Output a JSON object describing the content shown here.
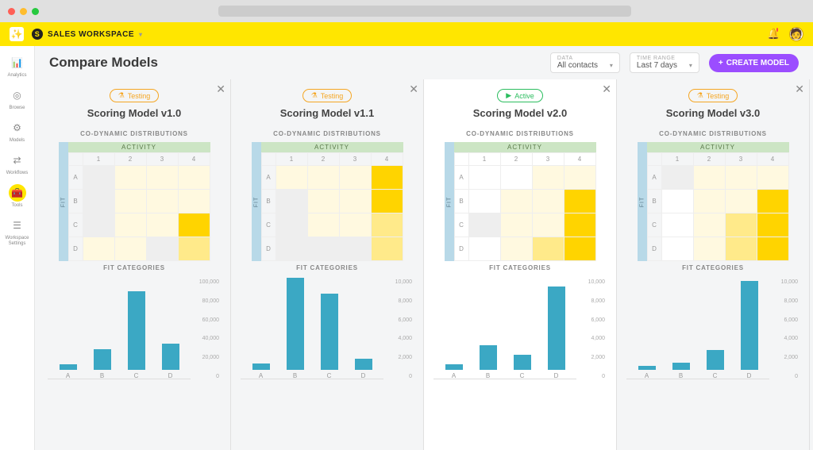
{
  "browser": {
    "traffic": [
      "red",
      "yellow",
      "green"
    ]
  },
  "topbar": {
    "workspace_label": "SALES WORKSPACE",
    "bell_icon": "🔔",
    "avatar_icon": "👤"
  },
  "sidebar": {
    "items": [
      {
        "icon": "📊",
        "label": "Analytics"
      },
      {
        "icon": "◎",
        "label": "Browse"
      },
      {
        "icon": "⚙",
        "label": "Models"
      },
      {
        "icon": "⇄",
        "label": "Workflows"
      },
      {
        "icon": "🧰",
        "label": "Tools",
        "active": true
      },
      {
        "icon": "☰",
        "label": "Workspace Settings"
      }
    ]
  },
  "header": {
    "title": "Compare Models",
    "data_label": "DATA",
    "data_value": "All contacts",
    "time_label": "TIME RANGE",
    "time_value": "Last 7 days",
    "create_label": "CREATE MODEL"
  },
  "status_labels": {
    "testing": "Testing",
    "active": "Active"
  },
  "section_labels": {
    "distributions": "CO-DYNAMIC DISTRIBUTIONS",
    "activity": "ACTIVITY",
    "fit": "FIT",
    "fit_categories": "FIT CATEGORIES"
  },
  "heatmap_axes": {
    "cols": [
      "1",
      "2",
      "3",
      "4"
    ],
    "rows": [
      "A",
      "B",
      "C",
      "D"
    ]
  },
  "panels": [
    {
      "status": "testing",
      "title": "Scoring Model v1.0",
      "heatmap": [
        [
          2,
          1,
          1,
          1
        ],
        [
          2,
          1,
          1,
          1
        ],
        [
          2,
          1,
          1,
          5
        ],
        [
          1,
          1,
          2,
          3
        ]
      ],
      "highlight": false
    },
    {
      "status": "testing",
      "title": "Scoring Model v1.1",
      "heatmap": [
        [
          1,
          1,
          1,
          5
        ],
        [
          2,
          1,
          1,
          5
        ],
        [
          2,
          1,
          1,
          3
        ],
        [
          2,
          2,
          2,
          3
        ]
      ],
      "highlight": false
    },
    {
      "status": "active",
      "title": "Scoring Model v2.0",
      "heatmap": [
        [
          0,
          0,
          1,
          1
        ],
        [
          0,
          1,
          1,
          5
        ],
        [
          2,
          1,
          1,
          5
        ],
        [
          0,
          1,
          3,
          5
        ]
      ],
      "highlight": true
    },
    {
      "status": "testing",
      "title": "Scoring Model v3.0",
      "heatmap": [
        [
          2,
          1,
          1,
          1
        ],
        [
          0,
          1,
          1,
          5
        ],
        [
          0,
          1,
          3,
          5
        ],
        [
          0,
          1,
          3,
          5
        ]
      ],
      "highlight": false
    }
  ],
  "chart_data": [
    {
      "type": "bar",
      "title": "FIT CATEGORIES",
      "categories": [
        "A",
        "B",
        "C",
        "D"
      ],
      "values": [
        6000,
        22000,
        84000,
        28000
      ],
      "ylim": [
        0,
        100000
      ],
      "y_ticks": [
        "100,000",
        "80,000",
        "60,000",
        "40,000",
        "20,000",
        "0"
      ]
    },
    {
      "type": "bar",
      "title": "FIT CATEGORIES",
      "categories": [
        "A",
        "B",
        "C",
        "D"
      ],
      "values": [
        700,
        9800,
        8100,
        1200
      ],
      "ylim": [
        0,
        10000
      ],
      "y_ticks": [
        "10,000",
        "8,000",
        "6,000",
        "4,000",
        "2,000",
        "0"
      ]
    },
    {
      "type": "bar",
      "title": "FIT CATEGORIES",
      "categories": [
        "A",
        "B",
        "C",
        "D"
      ],
      "values": [
        600,
        2600,
        1600,
        8900
      ],
      "ylim": [
        0,
        10000
      ],
      "y_ticks": [
        "10,000",
        "8,000",
        "6,000",
        "4,000",
        "2,000",
        "0"
      ]
    },
    {
      "type": "bar",
      "title": "FIT CATEGORIES",
      "categories": [
        "A",
        "B",
        "C",
        "D"
      ],
      "values": [
        400,
        800,
        2100,
        9500
      ],
      "ylim": [
        0,
        10000
      ],
      "y_ticks": [
        "10,000",
        "8,000",
        "6,000",
        "4,000",
        "2,000",
        "0"
      ]
    }
  ],
  "heatmap_palette": [
    "#ffffff",
    "#fff9e0",
    "#eeeeee",
    "#ffea8a",
    "#ffe14a",
    "#ffd400"
  ]
}
